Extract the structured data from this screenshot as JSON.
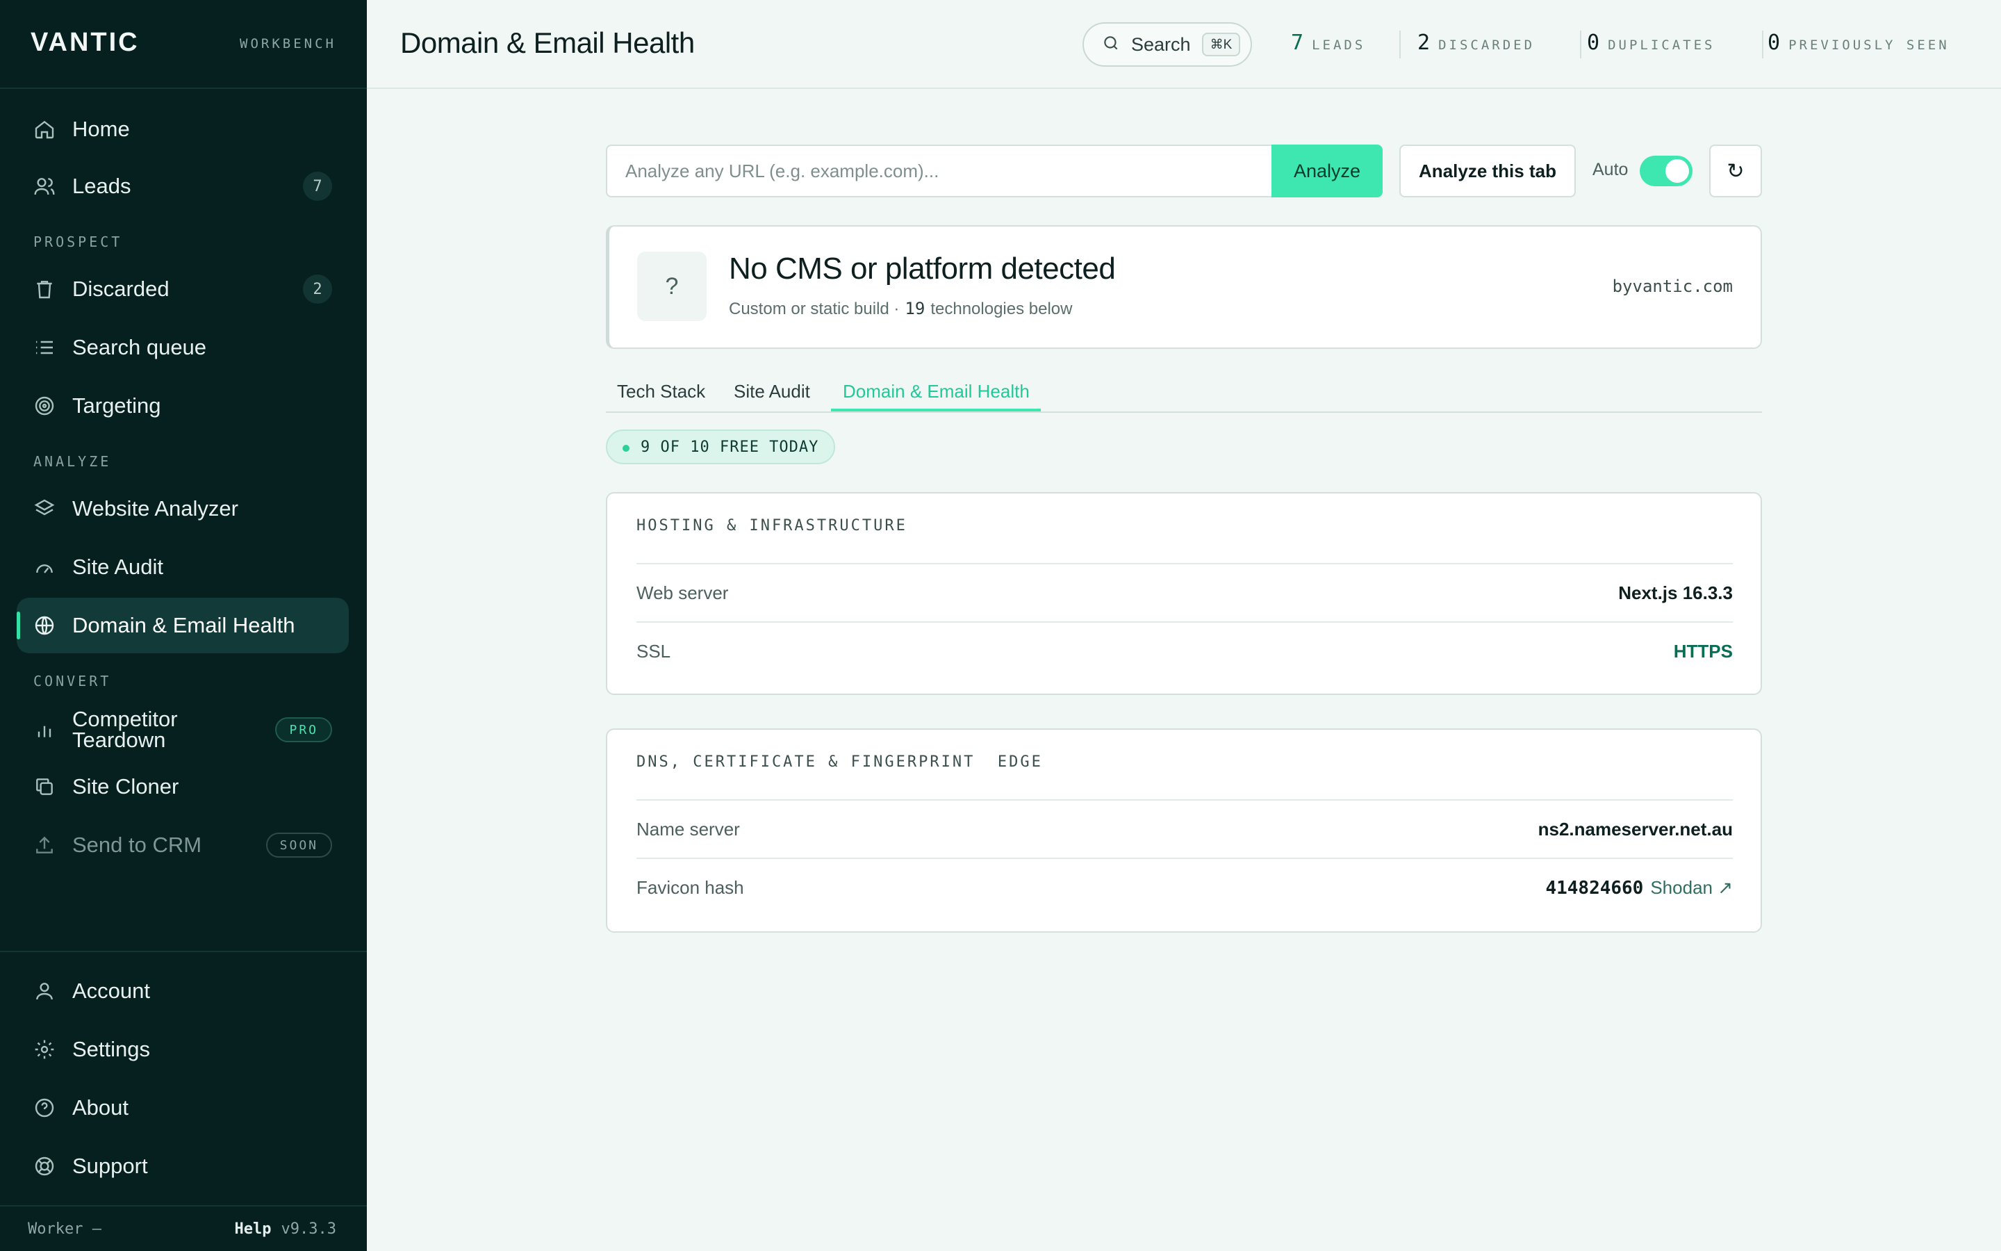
{
  "brand": {
    "logo": "VANTIC",
    "tag": "WORKBENCH"
  },
  "sidebar": {
    "home": "Home",
    "leads": {
      "label": "Leads",
      "count": "7"
    },
    "sections": {
      "prospect": "PROSPECT",
      "analyze": "ANALYZE",
      "convert": "CONVERT"
    },
    "discarded": {
      "label": "Discarded",
      "count": "2"
    },
    "search_queue": "Search queue",
    "targeting": "Targeting",
    "website_analyzer": "Website Analyzer",
    "site_audit": "Site Audit",
    "domain_email": "Domain & Email Health",
    "competitor": {
      "line1": "Competitor",
      "line2": "Teardown",
      "badge": "PRO"
    },
    "site_cloner": "Site Cloner",
    "send_crm": {
      "label": "Send to CRM",
      "badge": "SOON"
    },
    "account": "Account",
    "settings": "Settings",
    "about": "About",
    "support": "Support"
  },
  "footer": {
    "worker": "Worker —",
    "help": "Help",
    "version": "v9.3.3"
  },
  "header": {
    "title": "Domain & Email Health",
    "search": {
      "label": "Search",
      "shortcut": "⌘K"
    },
    "stats": [
      {
        "num": "7",
        "label": "LEADS"
      },
      {
        "num": "2",
        "label": "DISCARDED"
      },
      {
        "num": "0",
        "label": "DUPLICATES"
      },
      {
        "num": "0",
        "label": "PREVIOUSLY SEEN"
      }
    ]
  },
  "analyzer": {
    "placeholder": "Analyze any URL (e.g. example.com)...",
    "analyze_label": "Analyze",
    "analyze_tab_label": "Analyze this tab",
    "auto_label": "Auto",
    "auto_on": true,
    "refresh_glyph": "↻"
  },
  "cms": {
    "icon": "?",
    "title": "No CMS or platform detected",
    "subtitle_pre": "Custom or static build ·",
    "tech_count": "19",
    "subtitle_post": "technologies below",
    "domain": "byvantic.com"
  },
  "tabs": {
    "tech_stack": "Tech Stack",
    "site_audit": "Site Audit",
    "domain_email": "Domain & Email Health"
  },
  "quota": "9 OF 10 FREE TODAY",
  "hosting": {
    "title": "HOSTING & INFRASTRUCTURE",
    "rows": [
      {
        "key": "Web server",
        "value": "Next.js 16.3.3"
      },
      {
        "key": "SSL",
        "value": "HTTPS"
      }
    ]
  },
  "dns": {
    "title": "DNS, CERTIFICATE & FINGERPRINT  EDGE",
    "name_server": {
      "key": "Name server",
      "value": "ns2.nameserver.net.au"
    },
    "favicon": {
      "key": "Favicon hash",
      "hash": "414824660",
      "link": "Shodan ↗"
    }
  },
  "colors": {
    "accent": "#3ee6b0",
    "sidebar_bg": "#05201f",
    "page_bg": "#f1f7f5",
    "ok_green": "#0a6e55"
  }
}
